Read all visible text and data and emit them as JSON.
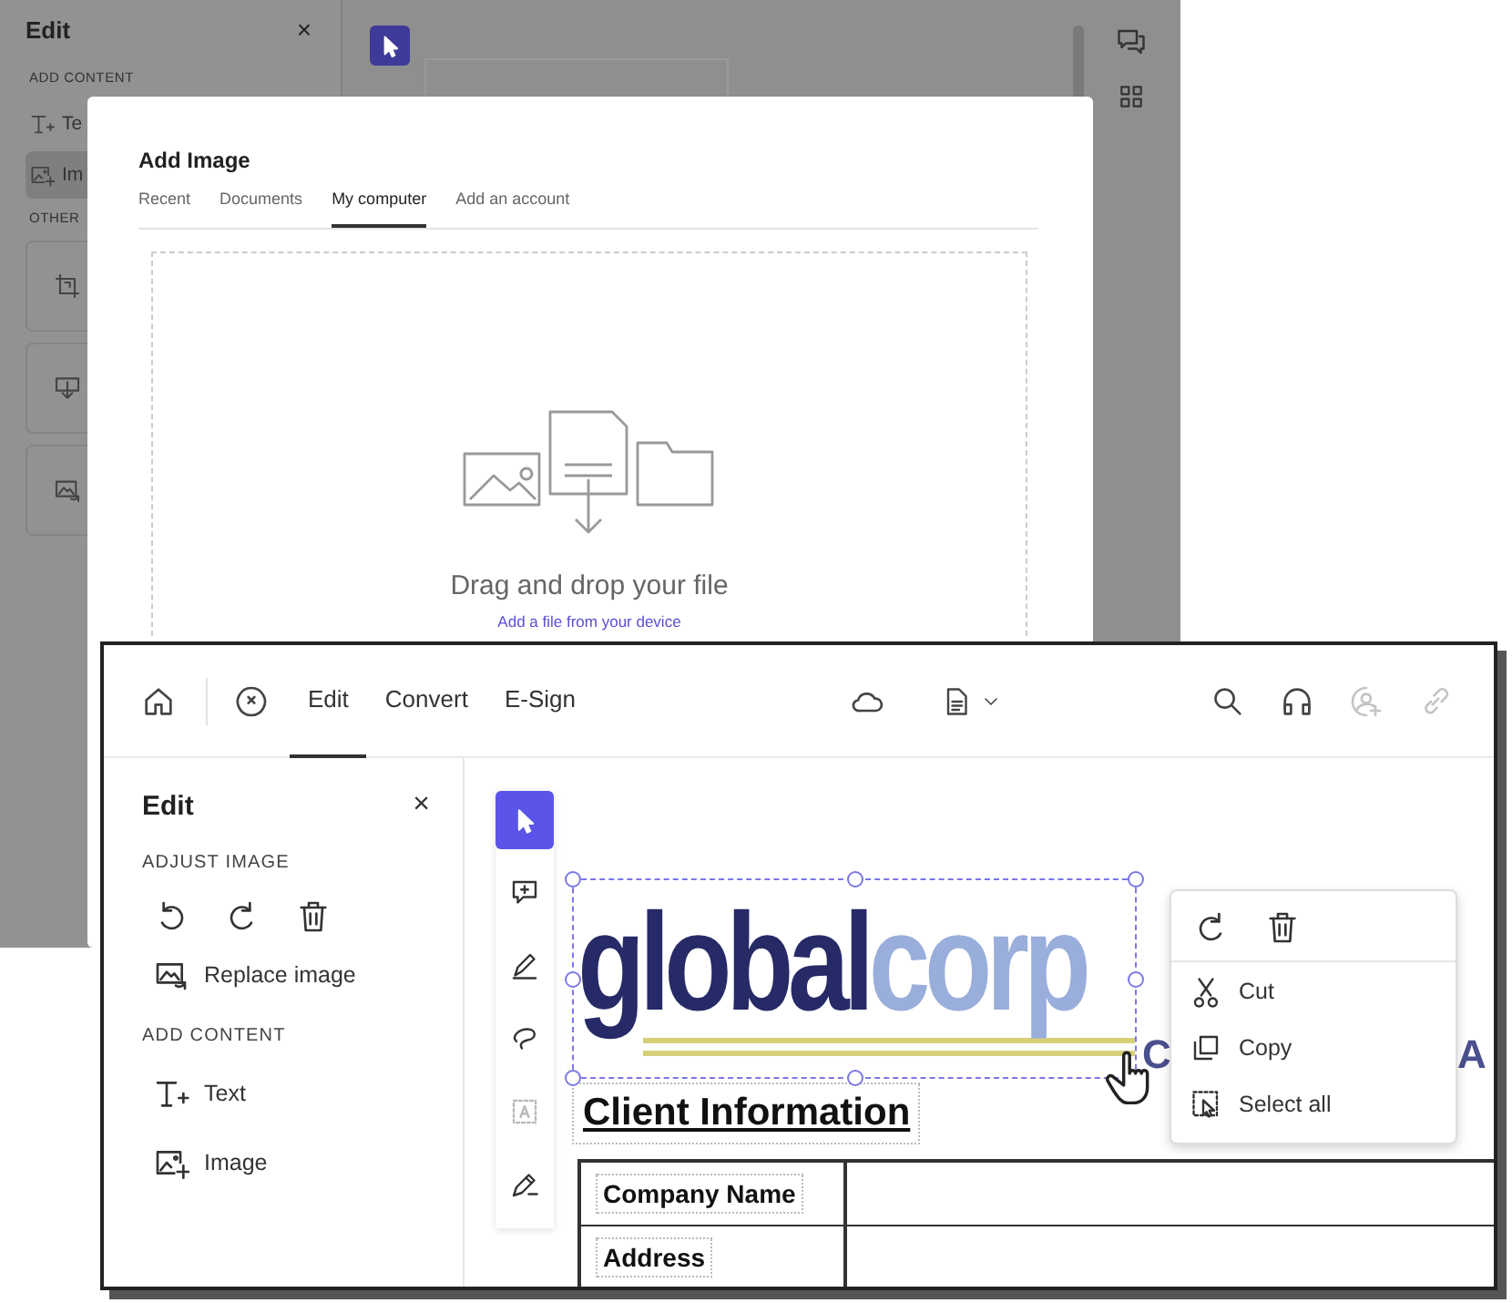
{
  "back_window": {
    "edit_panel": {
      "title": "Edit",
      "close": "×",
      "add_heading": "ADD CONTENT",
      "items": [
        {
          "kind": "text",
          "label": "Te",
          "selected": false
        },
        {
          "kind": "image",
          "label": "Im",
          "selected": true
        }
      ],
      "other_heading": "OTHER",
      "cards": [
        {
          "kind": "crop"
        },
        {
          "kind": "insert"
        },
        {
          "kind": "replace"
        }
      ]
    },
    "dialog": {
      "title": "Add Image",
      "tabs": [
        {
          "label": "Recent",
          "selected": false
        },
        {
          "label": "Documents",
          "selected": false
        },
        {
          "label": "My computer",
          "selected": true
        },
        {
          "label": "Add an account",
          "selected": false
        }
      ],
      "drop_title": "Drag and drop your file",
      "drop_link": "Add a file from your device"
    }
  },
  "front_window": {
    "tabs": [
      {
        "label": "Edit",
        "selected": true
      },
      {
        "label": "Convert",
        "selected": false
      },
      {
        "label": "E-Sign",
        "selected": false
      }
    ],
    "header_actions": [
      {
        "kind": "search",
        "disabled": false
      },
      {
        "kind": "headphones",
        "disabled": false
      },
      {
        "kind": "user-add",
        "disabled": true
      },
      {
        "kind": "link",
        "disabled": true
      }
    ],
    "edit_panel": {
      "title": "Edit",
      "close": "×",
      "adjust_heading": "ADJUST IMAGE",
      "replace_label": "Replace image",
      "add_heading": "ADD CONTENT",
      "add_items": [
        {
          "kind": "text",
          "label": "Text"
        },
        {
          "kind": "image",
          "label": "Image"
        }
      ]
    },
    "tools": [
      {
        "kind": "select",
        "selected": true,
        "disabled": false
      },
      {
        "kind": "comment",
        "selected": false,
        "disabled": false
      },
      {
        "kind": "highlight",
        "selected": false,
        "disabled": false
      },
      {
        "kind": "lasso",
        "selected": false,
        "disabled": false
      },
      {
        "kind": "textbox",
        "selected": false,
        "disabled": true
      },
      {
        "kind": "sign",
        "selected": false,
        "disabled": false
      }
    ],
    "document": {
      "logo": {
        "dark": "global",
        "light": "corp",
        "selected": true
      },
      "heading": "Client Information",
      "table_rows": [
        {
          "label": "Company Name"
        },
        {
          "label": "Address"
        }
      ],
      "cut_texts": [
        "C",
        "A"
      ]
    },
    "context_menu": {
      "items": [
        {
          "kind": "cut",
          "label": "Cut"
        },
        {
          "kind": "copy",
          "label": "Copy"
        },
        {
          "kind": "select-all",
          "label": "Select all"
        }
      ]
    }
  }
}
